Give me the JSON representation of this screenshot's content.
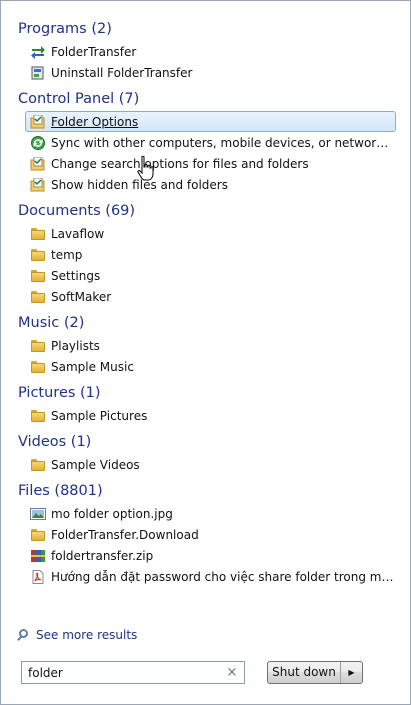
{
  "groups": [
    {
      "header": "Programs (2)",
      "items": [
        {
          "label": "FolderTransfer",
          "icon": "program-arrows-icon"
        },
        {
          "label": "Uninstall FolderTransfer",
          "icon": "uninstall-icon"
        }
      ]
    },
    {
      "header": "Control Panel (7)",
      "items": [
        {
          "label": "Folder Options",
          "icon": "folder-options-icon",
          "selected": true
        },
        {
          "label": "Sync with other computers, mobile devices, or network folders",
          "icon": "sync-center-icon"
        },
        {
          "label": "Change search options for files and folders",
          "icon": "folder-options-icon"
        },
        {
          "label": "Show hidden files and folders",
          "icon": "folder-options-icon"
        }
      ]
    },
    {
      "header": "Documents (69)",
      "items": [
        {
          "label": "Lavaflow",
          "icon": "folder-icon"
        },
        {
          "label": "temp",
          "icon": "folder-icon"
        },
        {
          "label": "Settings",
          "icon": "folder-icon"
        },
        {
          "label": "SoftMaker",
          "icon": "folder-icon"
        }
      ]
    },
    {
      "header": "Music (2)",
      "items": [
        {
          "label": "Playlists",
          "icon": "folder-icon"
        },
        {
          "label": "Sample Music",
          "icon": "folder-icon"
        }
      ]
    },
    {
      "header": "Pictures (1)",
      "items": [
        {
          "label": "Sample Pictures",
          "icon": "folder-icon"
        }
      ]
    },
    {
      "header": "Videos (1)",
      "items": [
        {
          "label": "Sample Videos",
          "icon": "folder-icon"
        }
      ]
    },
    {
      "header": "Files (8801)",
      "items": [
        {
          "label": "mo folder option.jpg",
          "icon": "image-file-icon"
        },
        {
          "label": "FolderTransfer.Download",
          "icon": "folder-icon"
        },
        {
          "label": "foldertransfer.zip",
          "icon": "zip-archive-icon"
        },
        {
          "label": "Hướng dẫn đặt password cho việc share folder trong mạng LA...",
          "icon": "pdf-file-icon"
        }
      ]
    }
  ],
  "see_more": "See more results",
  "search": {
    "value": "folder",
    "clear_symbol": "×"
  },
  "shutdown": {
    "label": "Shut down",
    "arrow": "▶"
  },
  "colors": {
    "header": "#1e3287",
    "selection_border": "#84acdd",
    "selection_bg": "#d3e6fb"
  }
}
